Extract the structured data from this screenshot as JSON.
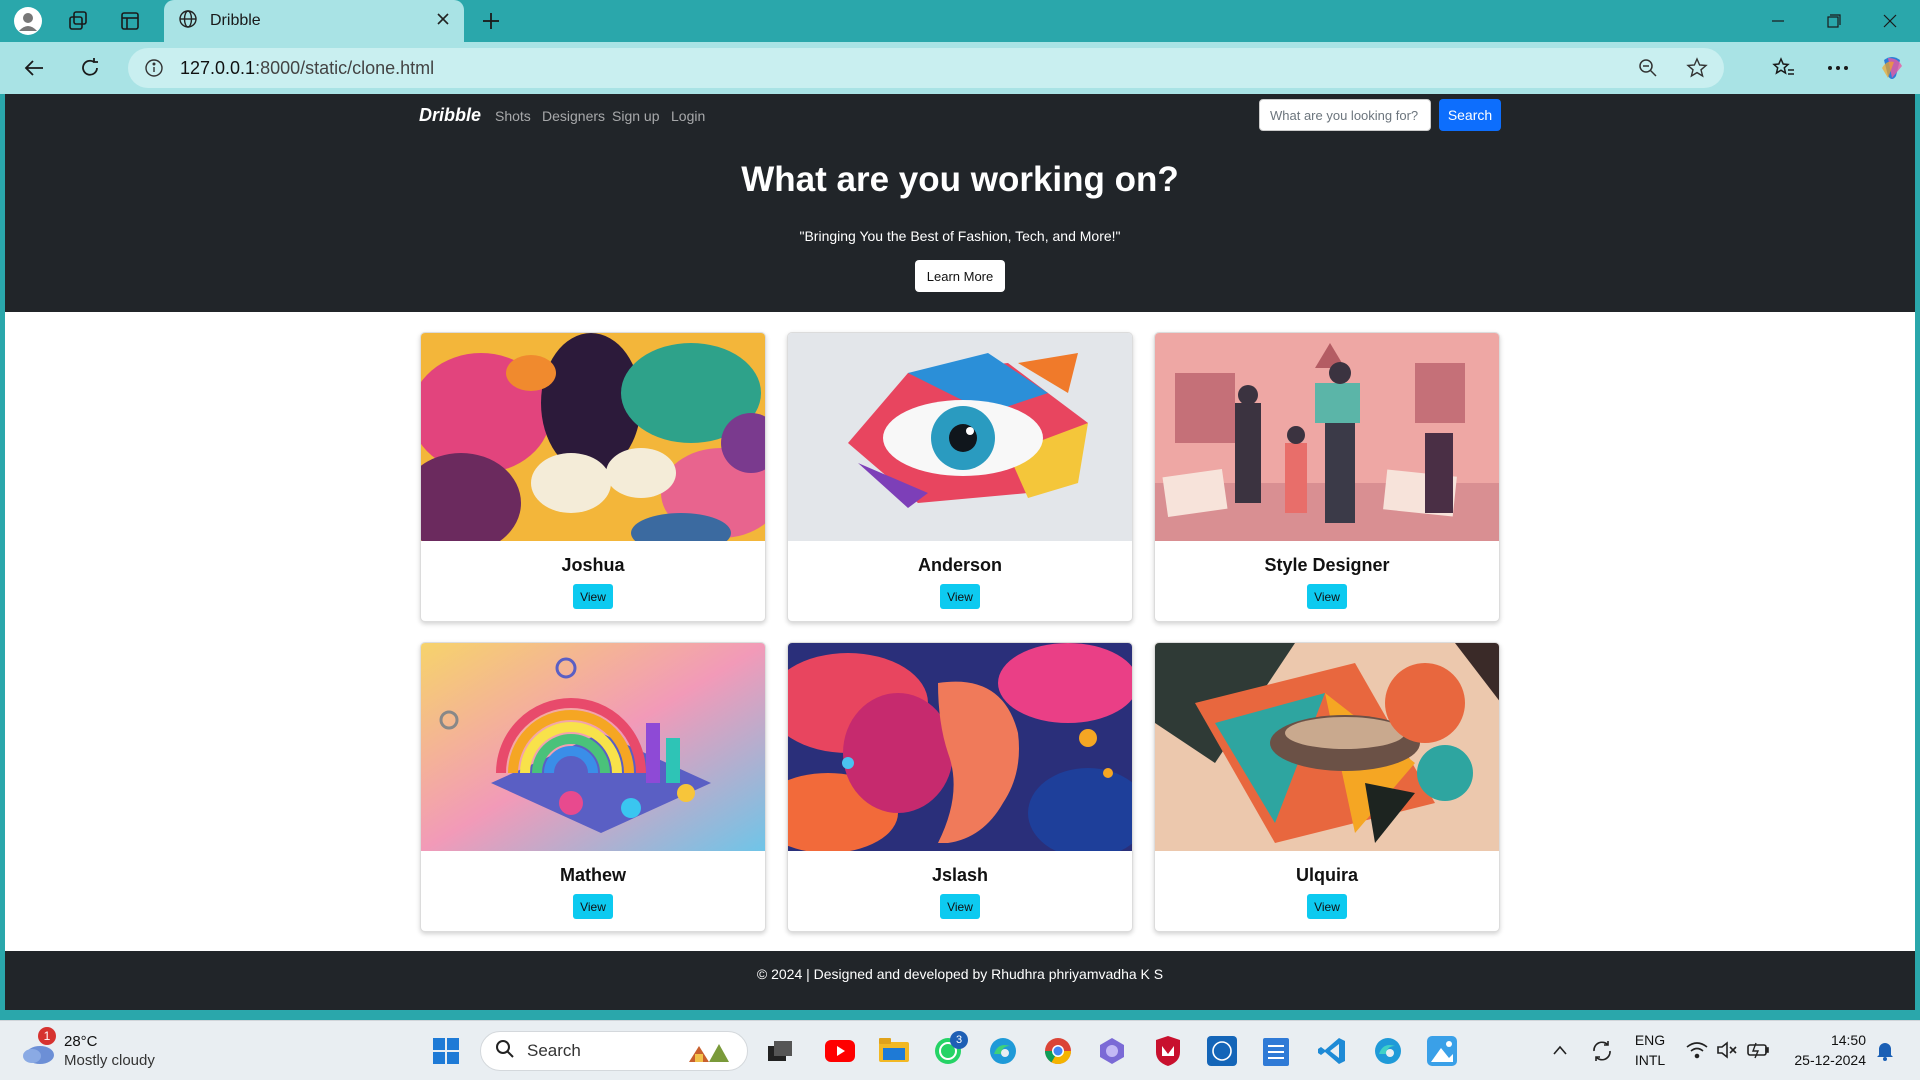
{
  "browser": {
    "tab_title": "Dribble",
    "address_host": "127.0.0.1",
    "address_path": ":8000/static/clone.html"
  },
  "site": {
    "brand": "Dribble",
    "nav": [
      "Shots",
      "Designers",
      "Sign up",
      "Login"
    ],
    "search_placeholder": "What are you looking for?",
    "search_button": "Search",
    "hero_title": "What are you working on?",
    "hero_subtitle": "\"Bringing You the Best of Fashion, Tech, and More!\"",
    "learn_more": "Learn More",
    "cards": [
      {
        "title": "Joshua",
        "button": "View"
      },
      {
        "title": "Anderson",
        "button": "View"
      },
      {
        "title": "Style Designer",
        "button": "View"
      },
      {
        "title": "Mathew",
        "button": "View"
      },
      {
        "title": "Jslash",
        "button": "View"
      },
      {
        "title": "Ulquira",
        "button": "View"
      }
    ],
    "footer": "© 2024 | Designed and developed by Rhudhra phriyamvadha K S"
  },
  "taskbar": {
    "weather_temp": "28°C",
    "weather_desc": "Mostly cloudy",
    "weather_badge": "1",
    "search_label": "Search",
    "whatsapp_badge": "3",
    "lang_top": "ENG",
    "lang_bottom": "INTL",
    "time": "14:50",
    "date": "25-12-2024"
  },
  "colors": {
    "chrome_teal": "#2aa7ab",
    "site_dark": "#212529",
    "primary": "#0d6efd",
    "info": "#0dcaf0"
  }
}
